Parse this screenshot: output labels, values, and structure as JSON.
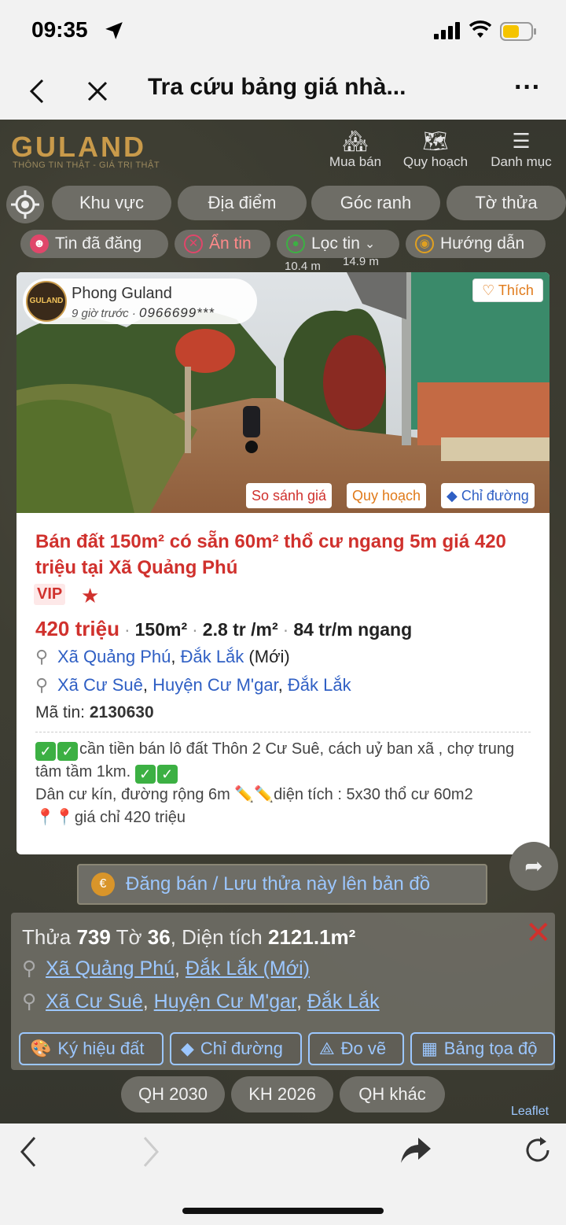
{
  "status": {
    "time": "09:35"
  },
  "nav": {
    "title": "Tra cứu bảng giá nhà...",
    "more": "···"
  },
  "header": {
    "logo": "GULAND",
    "tagline": "THÔNG TIN THẬT - GIÁ TRỊ THẬT",
    "buttons": [
      "Mua bán",
      "Quy hoạch",
      "Danh mục"
    ]
  },
  "filters": [
    "Khu vực",
    "Địa điểm",
    "Góc ranh",
    "Tờ thửa"
  ],
  "filters2": [
    "Tin đã đăng",
    "Ẩn tin",
    "Lọc tin",
    "Hướng dẫn"
  ],
  "map_labels": [
    "10.4 m",
    "14.9 m"
  ],
  "listing": {
    "avatar_text": "GULAND",
    "poster_name": "Phong Guland",
    "posted_ago": "9 giờ trước",
    "phone": "0966699***",
    "like": "Thích",
    "tags": [
      "So sánh giá",
      "Quy hoạch",
      "Chỉ đường"
    ],
    "title": "Bán đất 150m² có sẵn 60m² thổ cư ngang 5m giá 420 triệu tại Xã Quảng Phú",
    "vip": "VIP",
    "price": "420 triệu",
    "area": "150m²",
    "unit_price": "2.8 tr /m²",
    "frontage_price": "84 tr/m ngang",
    "location_new": {
      "commune": "Xã Quảng Phú",
      "province": "Đắk Lắk",
      "note": "(Mới)"
    },
    "location_old": {
      "commune": "Xã Cư Suê",
      "district": "Huyện Cư M'gar",
      "province": "Đắk Lắk"
    },
    "code_label": "Mã tin:",
    "code": "2130630",
    "desc_line1": "cần tiền bán lô đất Thôn 2 Cư Suê, cách uỷ ban xã , chợ trung tâm tầm 1km.",
    "desc_line2": "Dân cư kín, đường rộng 6m",
    "desc_line3": "diện tích : 5x30 thổ cư 60m2",
    "desc_line4": "giá chỉ 420 triệu"
  },
  "dang_ban": "Đăng bán / Lưu thửa này lên bản đồ",
  "parcel": {
    "thua_label": "Thửa",
    "thua": "739",
    "to_label": "Tờ",
    "to": "36",
    "dt_label": "Diện tích",
    "dt": "2121.1m²",
    "new": {
      "commune": "Xã Quảng Phú",
      "province": "Đắk Lắk (Mới)"
    },
    "old": {
      "commune": "Xã Cư Suê",
      "district": "Huyện Cư M'gar",
      "province": "Đắk Lắk"
    },
    "buttons": [
      "Ký hiệu đất",
      "Chỉ đường",
      "Đo vẽ",
      "Bảng tọa độ"
    ]
  },
  "plans": [
    "QH 2030",
    "KH 2026",
    "QH khác"
  ],
  "attribution": "Leaflet",
  "colors": {
    "accent_red": "#d0312d",
    "link_blue": "#2f5fc4",
    "brand_gold": "#c99a4a"
  }
}
